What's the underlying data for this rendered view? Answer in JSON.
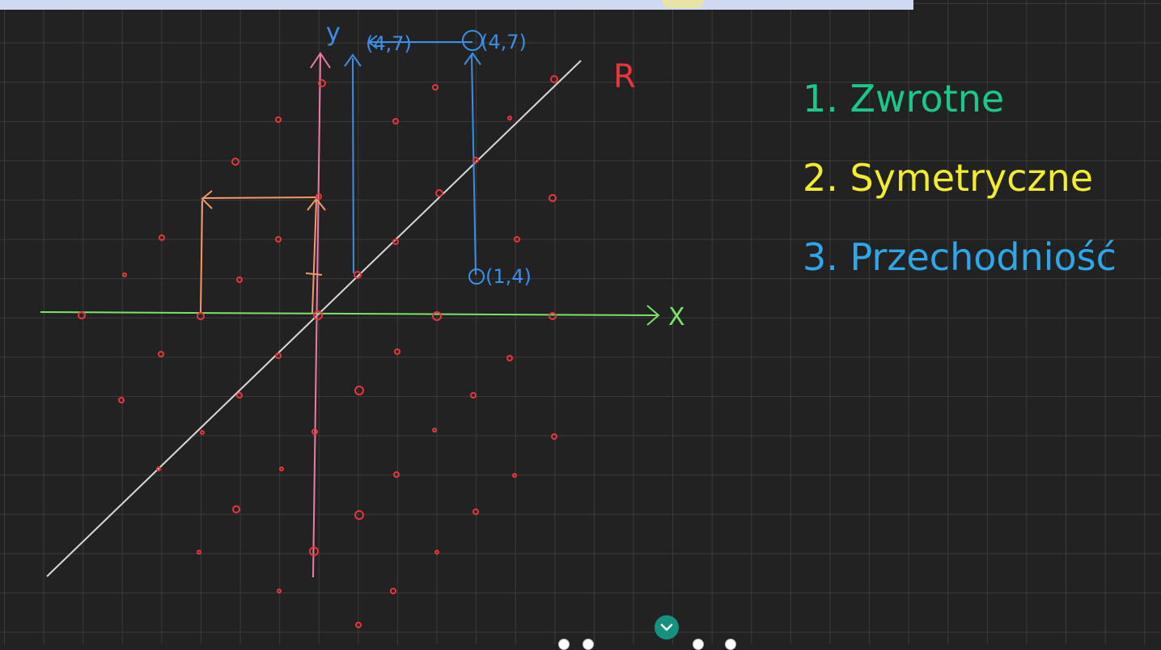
{
  "axes": {
    "x_label": "X",
    "y_label": "y"
  },
  "relation_label": "R",
  "points": {
    "top_left": "(4,7)",
    "top_right": "(4,7)",
    "bottom": "(1,4)"
  },
  "properties": [
    {
      "text": "1. Zwrotne",
      "color": "#19c98a"
    },
    {
      "text": "2. Symetryczne",
      "color": "#f2ec2e"
    },
    {
      "text": "3. Przechodniość",
      "color": "#2fa6e8"
    }
  ],
  "colors": {
    "background": "#222222",
    "grid": "#3a3a3a",
    "x_axis": "#7ee26b",
    "y_axis": "#f07aa9",
    "diagonal": "#d8d8d8",
    "dots": "#e8363a",
    "blue_marks": "#3a8fe6",
    "orange_marks": "#f39a6b",
    "nav_button": "#15917e"
  },
  "icons": {
    "scroll_down": "chevron-down-icon"
  }
}
